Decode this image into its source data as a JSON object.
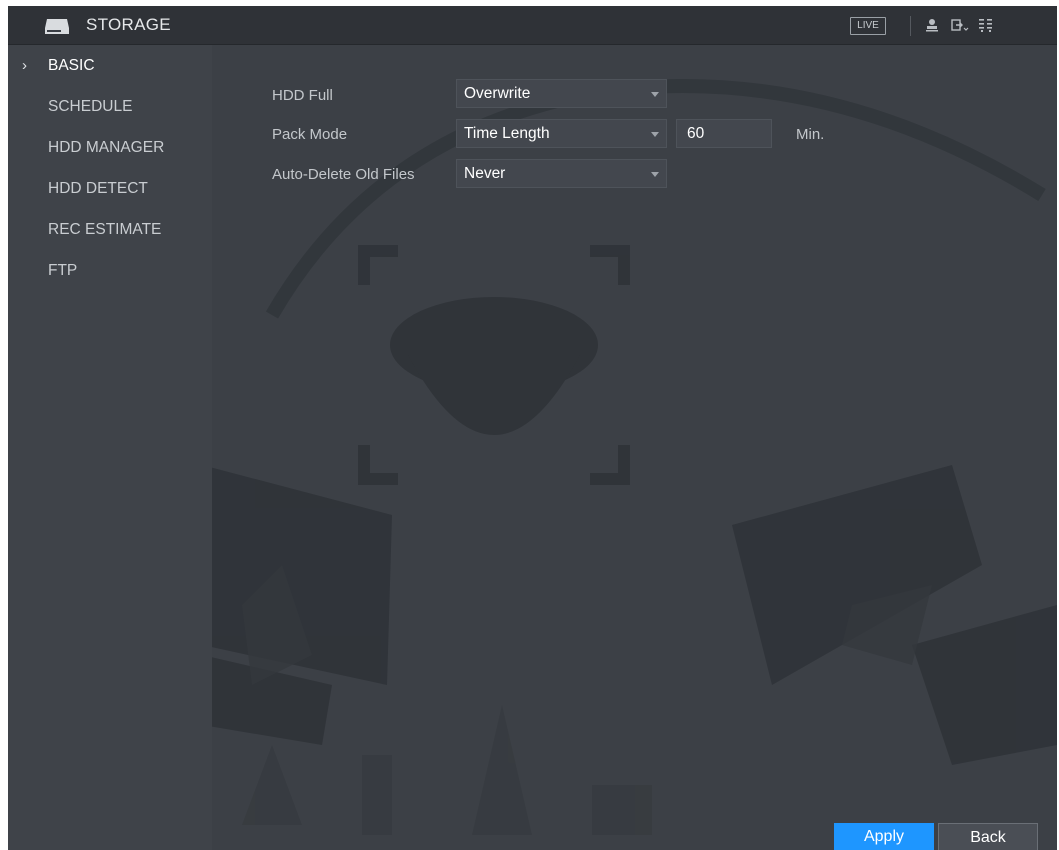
{
  "titlebar": {
    "title": "STORAGE",
    "live_label": "LIVE",
    "icons": [
      "storage-icon",
      "user-icon",
      "logout-icon",
      "grid-menu-icon"
    ]
  },
  "sidebar": {
    "items": [
      {
        "label": "BASIC",
        "active": true
      },
      {
        "label": "SCHEDULE",
        "active": false
      },
      {
        "label": "HDD MANAGER",
        "active": false
      },
      {
        "label": "HDD DETECT",
        "active": false
      },
      {
        "label": "REC ESTIMATE",
        "active": false
      },
      {
        "label": "FTP",
        "active": false
      }
    ]
  },
  "form": {
    "hdd_full": {
      "label": "HDD Full",
      "value": "Overwrite"
    },
    "pack_mode": {
      "label": "Pack Mode",
      "value": "Time Length",
      "length": "60",
      "unit": "Min."
    },
    "auto_delete": {
      "label": "Auto-Delete Old Files",
      "value": "Never"
    }
  },
  "buttons": {
    "apply": "Apply",
    "back": "Back"
  },
  "colors": {
    "accent": "#1e96ff",
    "background": "#3c4046",
    "sidebar": "#3f4349"
  }
}
